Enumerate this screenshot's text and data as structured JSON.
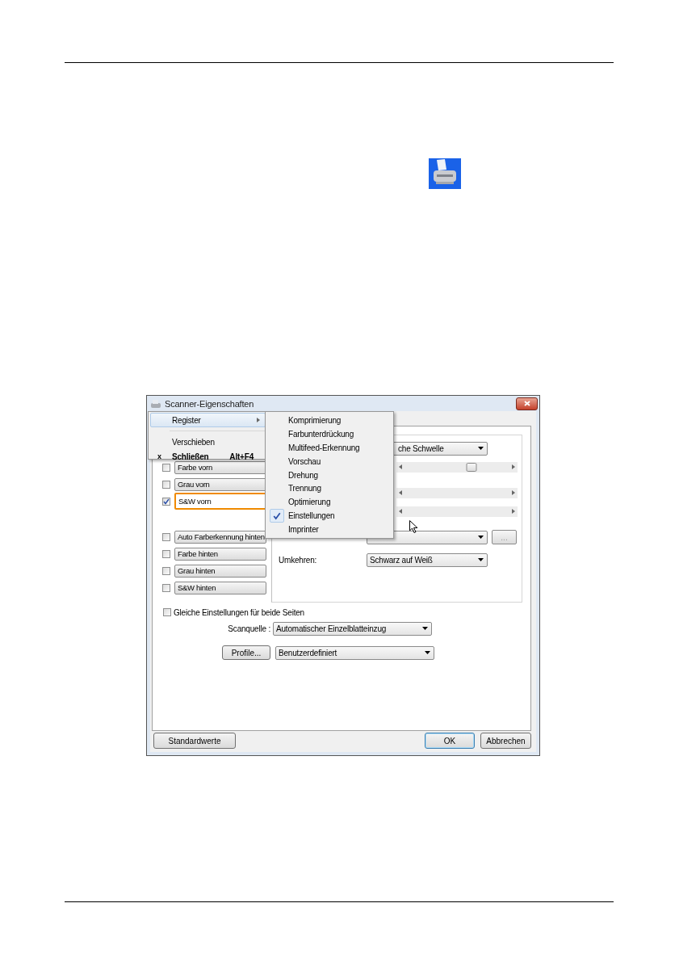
{
  "dialog": {
    "title": "Scanner-Eigenschaften"
  },
  "system_menu": {
    "items": [
      {
        "label": "Register",
        "kind": "submenu",
        "selected": true,
        "separator_after": true
      },
      {
        "label": "Verschieben",
        "kind": "plain",
        "selected": false,
        "separator_after": false
      },
      {
        "label": "Schließen",
        "kind": "bold",
        "mark": "x",
        "shortcut": "Alt+F4",
        "selected": false,
        "separator_after": false
      }
    ]
  },
  "submenu": {
    "items": [
      {
        "label": "Komprimierung",
        "checked": false
      },
      {
        "label": "Farbunterdrückung",
        "checked": false
      },
      {
        "label": "Multifeed-Erkennung",
        "checked": false
      },
      {
        "label": "Vorschau",
        "checked": false
      },
      {
        "label": "Drehung",
        "checked": false
      },
      {
        "label": "Trennung",
        "checked": false
      },
      {
        "label": "Optimierung",
        "checked": false
      },
      {
        "label": "Einstellungen",
        "checked": true
      },
      {
        "label": "Imprinter",
        "checked": false
      }
    ]
  },
  "front_sides": [
    {
      "label": "Farbe vorn",
      "checked": false,
      "selected": false
    },
    {
      "label": "Grau vorn",
      "checked": false,
      "selected": false
    },
    {
      "label": "S&W vorn",
      "checked": true,
      "selected": true
    }
  ],
  "back_sides": [
    {
      "label": "Auto Farberkennung hinten",
      "checked": false,
      "selected": false
    },
    {
      "label": "Farbe hinten",
      "checked": false,
      "selected": false
    },
    {
      "label": "Grau hinten",
      "checked": false,
      "selected": false
    },
    {
      "label": "S&W hinten",
      "checked": false,
      "selected": false
    }
  ],
  "settings": [
    {
      "kind": "dropdown",
      "value": "che Schwelle"
    },
    {
      "kind": "slider",
      "level": 0.64
    },
    {
      "kind": "slider"
    },
    {
      "kind": "slider"
    },
    {
      "kind": "dropdown_button",
      "button": "...",
      "disabled": true
    },
    {
      "kind": "dropdown",
      "label": "Umkehren:",
      "value": "Schwarz auf Weiß"
    }
  ],
  "same_settings": {
    "label": "Gleiche Einstellungen für beide Seiten",
    "checked": false
  },
  "scan_source": {
    "label": "Scanquelle :",
    "value": "Automatischer Einzelblatteinzug"
  },
  "profile": {
    "button": "Profile...",
    "value": "Benutzerdefiniert"
  },
  "buttons": [
    {
      "label": "Standardwerte",
      "kind": "reset"
    },
    {
      "label": "OK",
      "kind": "default"
    },
    {
      "label": "Abbrechen",
      "kind": "normal"
    }
  ]
}
